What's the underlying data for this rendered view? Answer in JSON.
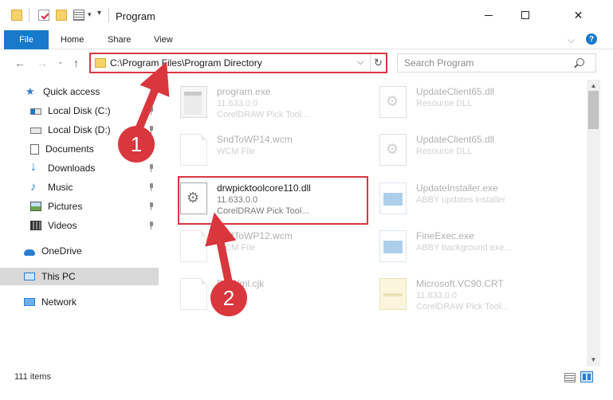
{
  "window": {
    "title": "Program",
    "close_glyph": "✕"
  },
  "ribbon": {
    "tabs": [
      "File",
      "Home",
      "Share",
      "View"
    ],
    "expand_glyph": "⌵",
    "help_glyph": "?"
  },
  "address": {
    "path": "C:\\Program Files\\Program Directory",
    "dropdown_glyph": "⌵",
    "refresh_glyph": "↻"
  },
  "nav": {
    "back_glyph": "←",
    "forward_glyph": "→",
    "recent_glyph": "⌄",
    "up_glyph": "↑"
  },
  "quick_access_toolbar": {
    "dropdown_glyph": "▾",
    "customize_glyph": "▾"
  },
  "search": {
    "placeholder": "Search Program"
  },
  "sidebar": {
    "items": [
      {
        "label": "Quick access",
        "icon": "star-icon"
      },
      {
        "label": "Local Disk (C:)",
        "icon": "drive-icon"
      },
      {
        "label": "Local Disk (D:)",
        "icon": "drive-icon"
      },
      {
        "label": "Documents",
        "icon": "documents-icon"
      },
      {
        "label": "Downloads",
        "icon": "download-icon"
      },
      {
        "label": "Music",
        "icon": "music-icon"
      },
      {
        "label": "Pictures",
        "icon": "pictures-icon"
      },
      {
        "label": "Videos",
        "icon": "videos-icon"
      },
      {
        "label": "OneDrive",
        "icon": "cloud-icon"
      },
      {
        "label": "This PC",
        "icon": "computer-icon"
      },
      {
        "label": "Network",
        "icon": "network-icon"
      }
    ]
  },
  "files": [
    {
      "name": "program.exe",
      "line1": "11.633.0.0",
      "line2": "CorelDRAW Pick Tool...",
      "icon": "exe-file-icon"
    },
    {
      "name": "UpdateClient65.dll",
      "line1": "Resource DLL",
      "line2": "",
      "icon": "dll-file-icon"
    },
    {
      "name": "SndToWP14.wcm",
      "line1": "WCM File",
      "line2": "",
      "icon": "blank-file-icon"
    },
    {
      "name": "UpdateClient65.dll",
      "line1": "Resource DLL",
      "line2": "",
      "icon": "dll-file-icon"
    },
    {
      "name": "drwpicktoolcore110.dll",
      "line1": "11.633.0.0",
      "line2": "CorelDRAW Pick Tool...",
      "icon": "dll-file-icon"
    },
    {
      "name": "UpdateInstaller.exe",
      "line1": "ABBY updates installer",
      "line2": "",
      "icon": "app-file-icon"
    },
    {
      "name": "SndToWP12.wcm",
      "line1": "WCM File",
      "line2": "",
      "icon": "blank-file-icon"
    },
    {
      "name": "FineExec.exe",
      "line1": "ABBY background exe...",
      "line2": "",
      "icon": "app-file-icon"
    },
    {
      "name": "DRWml.cjk",
      "line1": "",
      "line2": "",
      "icon": "blank-file-icon"
    },
    {
      "name": "Microsoft.VC90.CRT",
      "line1": "11.633.0.0",
      "line2": "CorelDRAW Pick Tool...",
      "icon": "cabinet-file-icon"
    }
  ],
  "status": {
    "item_count": "111 items"
  },
  "annotations": {
    "step1": "1",
    "step2": "2",
    "color": "#d9363e"
  },
  "colors": {
    "accent": "#1979ca",
    "highlight": "#d9363e"
  },
  "scrollbar": {
    "up_glyph": "▲",
    "down_glyph": "▼"
  }
}
